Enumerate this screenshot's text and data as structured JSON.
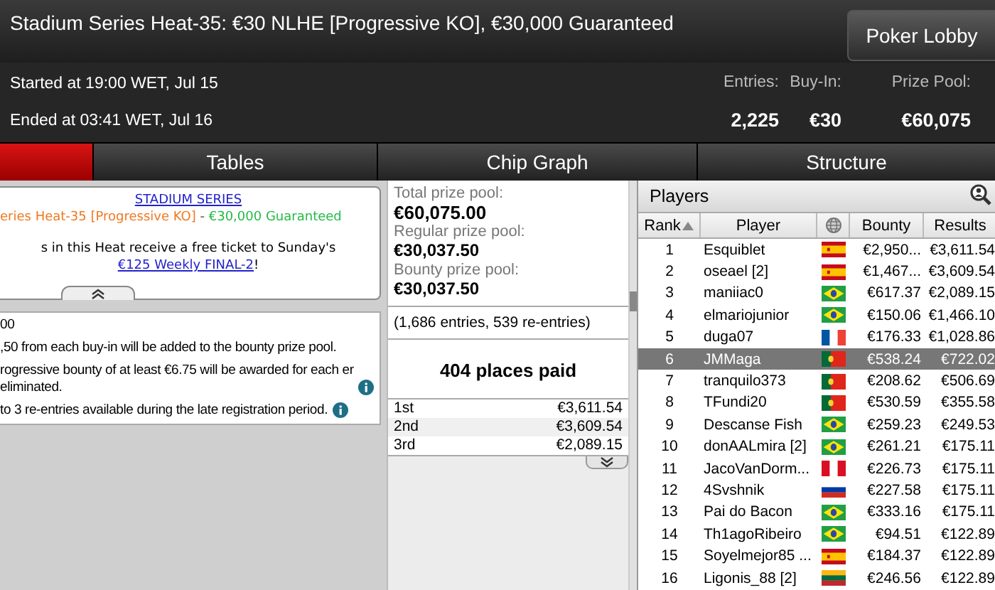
{
  "window": {
    "title": "Stadium Series Heat-35: €30 NLHE [Progressive KO], €30,000 Guaranteed"
  },
  "lobby_button": "Poker Lobby",
  "times": [
    "Started at 19:00 WET, Jul 15",
    "Ended at 03:41 WET, Jul 16"
  ],
  "stats": [
    {
      "label": "Entries:",
      "value": "2,225"
    },
    {
      "label": "Buy-In:",
      "value": "€30"
    },
    {
      "label": "Prize Pool:",
      "value": "€60,075"
    }
  ],
  "tabs": [
    {
      "selected": true
    },
    {
      "label": "Tables",
      "selected": false
    },
    {
      "label": "Chip Graph",
      "selected": false
    },
    {
      "label": "Structure",
      "selected": false
    }
  ],
  "promo": {
    "link": "STADIUM SERIES",
    "event": "eries Heat-35 [Progressive KO]",
    "separator": " - ",
    "guarantee": "€30,000 Guaranteed",
    "text": "s in this Heat receive a free ticket to Sunday's ",
    "ticket_link": "€125 Weekly FINAL-2",
    "end": "!"
  },
  "notes": [
    {
      "text": "00"
    },
    {
      "text": ",50 from each buy-in will be added to the bounty prize pool."
    },
    {
      "text": "rogressive bounty of at least €6.75 will be awarded for each er eliminated.",
      "info": true
    },
    {
      "text": "to 3 re-entries available during the late registration period.",
      "info": true
    }
  ],
  "prize_pools": [
    {
      "label": "Total prize pool:",
      "value": "€60,075.00"
    },
    {
      "label": "Regular prize pool:",
      "value": "€30,037.50"
    },
    {
      "label": "Bounty prize pool:",
      "value": "€30,037.50"
    }
  ],
  "entries_note": "(1,686 entries, 539 re-entries)",
  "places_paid": "404 places paid",
  "payouts": [
    {
      "place": "1st",
      "amount": "€3,611.54"
    },
    {
      "place": "2nd",
      "amount": "€3,609.54"
    },
    {
      "place": "3rd",
      "amount": "€2,089.15"
    }
  ],
  "players": {
    "title": "Players",
    "columns": [
      "Rank",
      "Player",
      "Bounty",
      "Results"
    ],
    "rows": [
      {
        "rank": "1",
        "name": "Esquiblet",
        "kind": "es",
        "bounty": "€2,950...",
        "result": "€3,611.54",
        "selected": false
      },
      {
        "rank": "2",
        "name": "oseael [2]",
        "kind": "es",
        "bounty": "€1,467...",
        "result": "€3,609.54",
        "selected": false
      },
      {
        "rank": "3",
        "name": "maniiac0",
        "kind": "br",
        "bounty": "€617.37",
        "result": "€2,089.15",
        "selected": false
      },
      {
        "rank": "4",
        "name": "elmariojunior",
        "kind": "br",
        "bounty": "€150.06",
        "result": "€1,466.10",
        "selected": false
      },
      {
        "rank": "5",
        "name": "duga07",
        "kind": "fr",
        "bounty": "€176.33",
        "result": "€1,028.86",
        "selected": false
      },
      {
        "rank": "6",
        "name": "JMMaga",
        "kind": "pt",
        "bounty": "€538.24",
        "result": "€722.02",
        "selected": true
      },
      {
        "rank": "7",
        "name": "tranquilo373",
        "kind": "pt",
        "bounty": "€208.62",
        "result": "€506.69",
        "selected": false
      },
      {
        "rank": "8",
        "name": "TFundi20",
        "kind": "pt",
        "bounty": "€530.59",
        "result": "€355.58",
        "selected": false
      },
      {
        "rank": "9",
        "name": "Descanse Fish",
        "kind": "br",
        "bounty": "€259.23",
        "result": "€249.53",
        "selected": false
      },
      {
        "rank": "10",
        "name": "donAALmira [2]",
        "kind": "br",
        "bounty": "€261.21",
        "result": "€175.11",
        "selected": false
      },
      {
        "rank": "11",
        "name": "JacoVanDorm...",
        "kind": "pe",
        "bounty": "€226.73",
        "result": "€175.11",
        "selected": false
      },
      {
        "rank": "12",
        "name": "4Svshnik",
        "kind": "ru",
        "bounty": "€227.58",
        "result": "€175.11",
        "selected": false
      },
      {
        "rank": "13",
        "name": "Pai do Bacon",
        "kind": "br",
        "bounty": "€333.16",
        "result": "€175.11",
        "selected": false
      },
      {
        "rank": "14",
        "name": "Th1agoRibeiro",
        "kind": "br",
        "bounty": "€94.51",
        "result": "€122.89",
        "selected": false
      },
      {
        "rank": "15",
        "name": "Soyelmejor85 ...",
        "kind": "es",
        "bounty": "€184.37",
        "result": "€122.89",
        "selected": false
      },
      {
        "rank": "16",
        "name": "Ligonis_88 [2]",
        "kind": "lt",
        "bounty": "€246.56",
        "result": "€122.89",
        "selected": false
      }
    ]
  }
}
